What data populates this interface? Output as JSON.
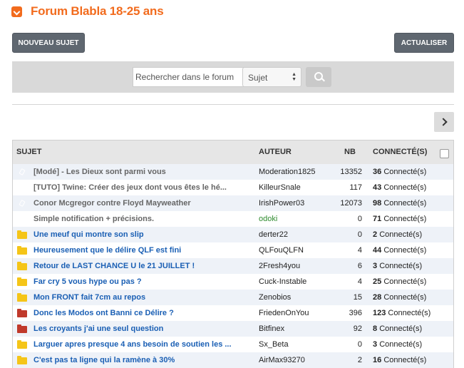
{
  "header": {
    "title": "Forum Blabla 18-25 ans",
    "accent": "#f26b1d"
  },
  "toolbar": {
    "new_topic": "NOUVEAU SUJET",
    "refresh": "ACTUALISER"
  },
  "search": {
    "placeholder": "Rechercher dans le forum",
    "scope_selected": "Sujet"
  },
  "table": {
    "headers": {
      "topic": "SUJET",
      "author": "AUTEUR",
      "count": "NB",
      "connected": "CONNECTÉ(S)"
    },
    "rows": [
      {
        "icon": "pin-green",
        "title": "[Modé] - Les Dieux sont parmi vous",
        "author": "Moderation1825",
        "nb": "13352",
        "conn": "36",
        "suffix": "Connecté(s)"
      },
      {
        "icon": "pin-green",
        "title": "[TUTO] Twine: Créer des jeux dont vous êtes le hé...",
        "author": "KilleurSnale",
        "nb": "117",
        "conn": "43",
        "suffix": "Connecté(s)"
      },
      {
        "icon": "pin-green",
        "title": "Conor Mcgregor contre Floyd Mayweather",
        "author": "IrishPower03",
        "nb": "12073",
        "conn": "98",
        "suffix": "Connecté(s)"
      },
      {
        "icon": "pin-red",
        "title": "Simple notification + précisions.",
        "author": "odoki",
        "nb": "0",
        "conn": "71",
        "suffix": "Connecté(s)"
      },
      {
        "icon": "folder-yellow",
        "title": "Une meuf qui montre son slip",
        "author": "derter22",
        "nb": "0",
        "conn": "2",
        "suffix": "Connecté(s)"
      },
      {
        "icon": "folder-yellow",
        "title": "Heureusement que le délire QLF est fini",
        "author": "QLFouQLFN",
        "nb": "4",
        "conn": "44",
        "suffix": "Connecté(s)"
      },
      {
        "icon": "folder-yellow",
        "title": "Retour de LAST CHANCE U le 21 JUILLET !",
        "author": "2Fresh4you",
        "nb": "6",
        "conn": "3",
        "suffix": "Connecté(s)"
      },
      {
        "icon": "folder-yellow",
        "title": "Far cry 5 vous hype ou pas ?",
        "author": "Cuck-Instable",
        "nb": "4",
        "conn": "25",
        "suffix": "Connecté(s)"
      },
      {
        "icon": "folder-yellow",
        "title": "Mon FRONT fait 7cm au repos",
        "author": "Zenobios",
        "nb": "15",
        "conn": "28",
        "suffix": "Connecté(s)"
      },
      {
        "icon": "folder-red",
        "title": "Donc les Modos ont Banni ce Délire ?",
        "author": "FriedenOnYou",
        "nb": "396",
        "conn": "123",
        "suffix": "Connecté(s)"
      },
      {
        "icon": "folder-red",
        "title": "Les croyants j'ai une seul question",
        "author": "Bitfinex",
        "nb": "92",
        "conn": "8",
        "suffix": "Connecté(s)"
      },
      {
        "icon": "folder-yellow",
        "title": "Larguer apres presque 4 ans besoin de soutien les ...",
        "author": "Sx_Beta",
        "nb": "0",
        "conn": "3",
        "suffix": "Connecté(s)"
      },
      {
        "icon": "folder-yellow",
        "title": "C'est pas ta ligne qui la ramène à 30%",
        "author": "AirMax93270",
        "nb": "2",
        "conn": "16",
        "suffix": "Connecté(s)"
      }
    ]
  }
}
